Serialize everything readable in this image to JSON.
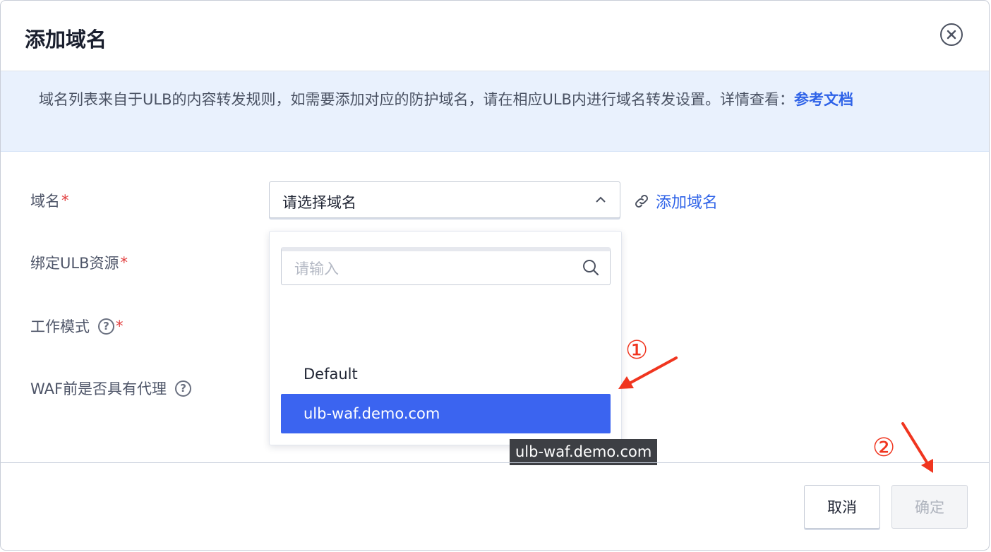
{
  "dialog": {
    "title": "添加域名"
  },
  "notice": {
    "text": "域名列表来自于ULB的内容转发规则，如需要添加对应的防护域名，请在相应ULB内进行域名转发设置。详情查看：",
    "link": "参考文档"
  },
  "form": {
    "domain_label": "域名",
    "ulb_label": "绑定ULB资源",
    "mode_label": "工作模式",
    "proxy_label": "WAF前是否具有代理",
    "required_mark": "*",
    "help_mark": "?"
  },
  "domain_select": {
    "value": "请选择域名",
    "add_link": "添加域名"
  },
  "dropdown": {
    "search_placeholder": "请输入",
    "options": [
      "Default",
      "ulb-waf.demo.com"
    ],
    "selected_index": 1,
    "tooltip": "ulb-waf.demo.com"
  },
  "footer": {
    "cancel_label": "取消",
    "ok_label": "确定"
  },
  "annotations": {
    "step1": "①",
    "step2": "②",
    "color": "#f0351f"
  },
  "colors": {
    "primary": "#3b64f0",
    "link": "#2f63e8",
    "notice_bg": "#e9f1fd",
    "required": "#e23d3d"
  }
}
